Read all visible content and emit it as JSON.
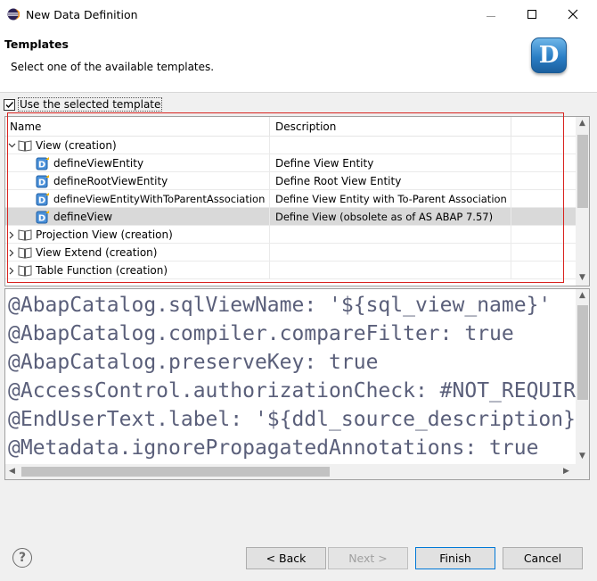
{
  "window": {
    "title": "New Data Definition"
  },
  "header": {
    "title": "Templates",
    "description": "Select one of the available templates.",
    "logo_letter": "D"
  },
  "use_template": {
    "label": "Use the selected template",
    "checked": true
  },
  "tree": {
    "columns": [
      "Name",
      "Description"
    ],
    "rows": [
      {
        "name": "View (creation)",
        "description": "",
        "type": "folder",
        "expanded": true,
        "level": 0
      },
      {
        "name": "defineViewEntity",
        "description": "Define View Entity",
        "type": "template",
        "level": 1
      },
      {
        "name": "defineRootViewEntity",
        "description": "Define Root View Entity",
        "type": "template",
        "level": 1
      },
      {
        "name": "defineViewEntityWithToParentAssociation",
        "description": "Define View Entity with To-Parent Association",
        "type": "template",
        "level": 1
      },
      {
        "name": "defineView",
        "description": "Define View (obsolete as of AS ABAP 7.57)",
        "type": "template",
        "level": 1,
        "selected": true
      },
      {
        "name": "Projection View (creation)",
        "description": "",
        "type": "folder",
        "expanded": false,
        "level": 0
      },
      {
        "name": "View Extend (creation)",
        "description": "",
        "type": "folder",
        "expanded": false,
        "level": 0
      },
      {
        "name": "Table Function (creation)",
        "description": "",
        "type": "folder",
        "expanded": false,
        "level": 0
      }
    ]
  },
  "preview": {
    "lines": [
      "@AbapCatalog.sqlViewName: '${sql_view_name}'",
      "@AbapCatalog.compiler.compareFilter: true",
      "@AbapCatalog.preserveKey: true",
      "@AccessControl.authorizationCheck: #NOT_REQUIRED",
      "@EndUserText.label: '${ddl_source_description}'",
      "@Metadata.ignorePropagatedAnnotations: true"
    ]
  },
  "buttons": {
    "help": "?",
    "back": "< Back",
    "next": "Next >",
    "finish": "Finish",
    "cancel": "Cancel"
  },
  "colors": {
    "accent": "#0078d7",
    "highlight_box": "#d9231f",
    "code_text": "#5a5f7a",
    "selected_row": "#d9d9d9"
  }
}
